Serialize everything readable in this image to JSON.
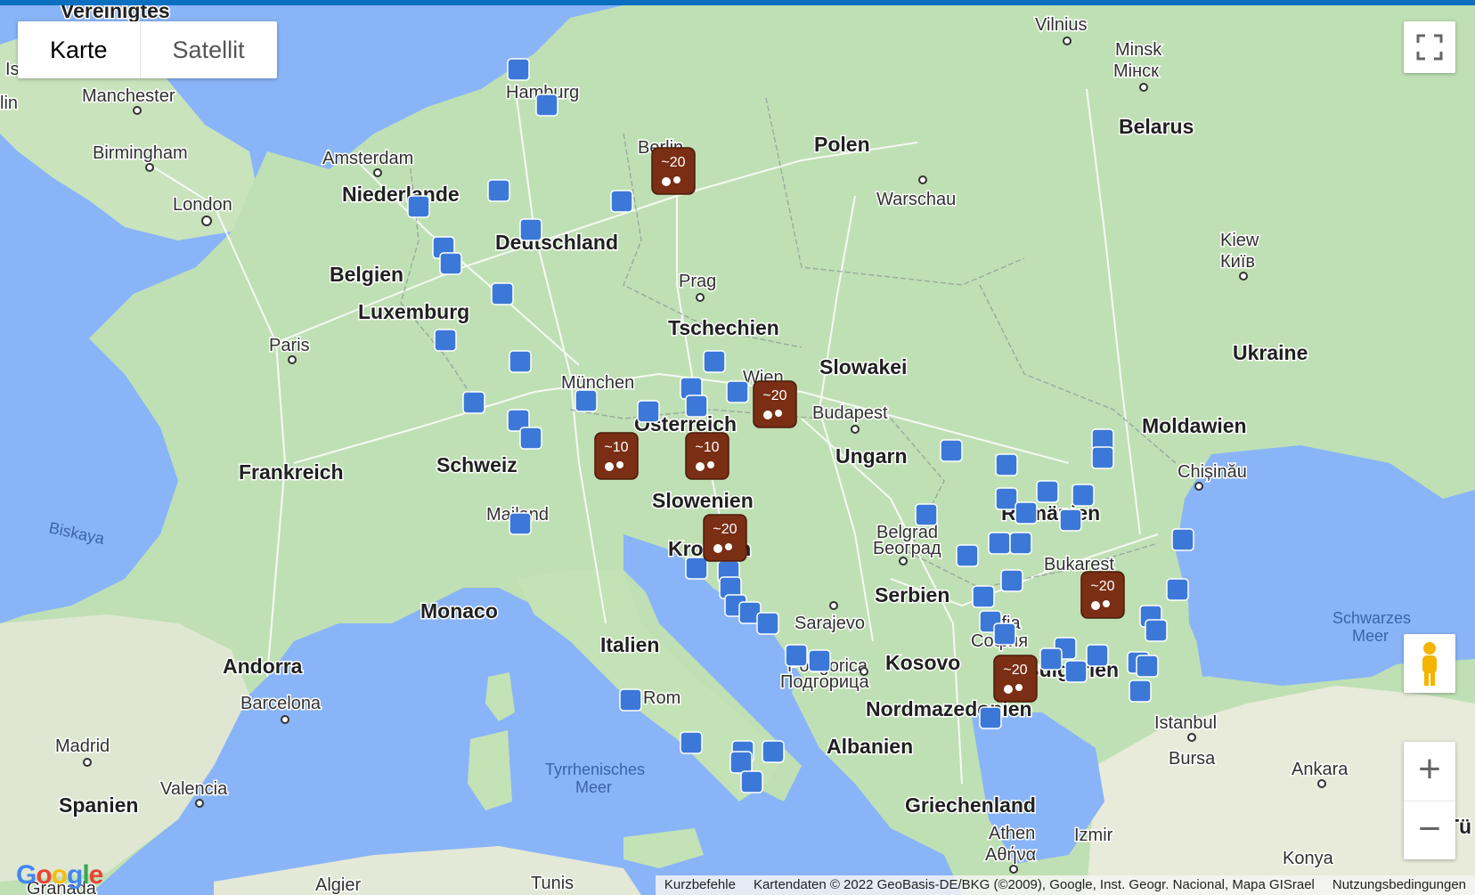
{
  "map_type": {
    "map": "Karte",
    "satellite": "Satellit"
  },
  "attribution": {
    "shortcuts": "Kurzbefehle",
    "data": "Kartendaten © 2022 GeoBasis-DE/BKG (©2009), Google, Inst. Geogr. Nacional, Mapa GISrael",
    "terms": "Nutzungsbedingungen"
  },
  "logo": "Google",
  "colors": {
    "water": "#8ab4f8",
    "land": "#bfe0b4",
    "land_light": "#e9ecdf",
    "cluster": "#7a2e14",
    "marker": "#3c78d8"
  },
  "labels": {
    "countries": [
      "Vereinigtes",
      "Niederlande",
      "Deutschland",
      "Belgien",
      "Luxemburg",
      "Frankreich",
      "Schweiz",
      "Österreich",
      "Tschechien",
      "Polen",
      "Slowakei",
      "Ungarn",
      "Slowenien",
      "Kroatien",
      "Italien",
      "Monaco",
      "Andorra",
      "Spanien",
      "Serbien",
      "Kosovo",
      "Nordmazedonien",
      "Albanien",
      "Griechenland",
      "Rumänien",
      "Moldawien",
      "Ukraine",
      "Belarus",
      "Bulgarien",
      "Tü"
    ],
    "cities": [
      "Manchester",
      "Birmingham",
      "London",
      "Amsterdam",
      "Hamburg",
      "Berlin",
      "Warschau",
      "Vilnius",
      "Minsk",
      "Мінск",
      "Kiew",
      "Київ",
      "Prag",
      "Wien",
      "Budapest",
      "München",
      "Paris",
      "Mailand",
      "Rom",
      "Barcelona",
      "Madrid",
      "Valencia",
      "Belgrad",
      "Београд",
      "Sarajevo",
      "Podgorica",
      "Подгорица",
      "Sofia",
      "София",
      "Bukarest",
      "Chișinău",
      "Istanbul",
      "Bursa",
      "Ankara",
      "Izmir",
      "Athen",
      "Αθήνα",
      "Tunis",
      "Algier",
      "Granada",
      "Konya",
      "lin",
      "Is"
    ],
    "seas": [
      "Biskaya",
      "Tyrrhenisches",
      "Meer",
      "Schwarzes",
      "Meer"
    ]
  },
  "clusters": [
    "~20",
    "~10",
    "~10",
    "~20",
    "~20",
    "~20",
    "~20"
  ]
}
